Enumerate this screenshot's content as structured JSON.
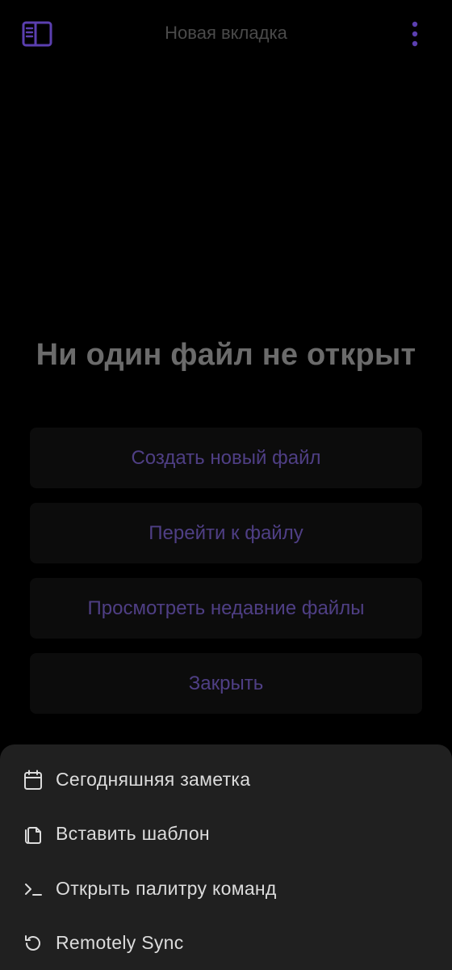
{
  "topbar": {
    "title": "Новая вкладка",
    "sidebar_icon": "sidebar-toggle-icon",
    "more_icon": "more-vertical-icon"
  },
  "empty_state": {
    "title": "Ни один файл не открыт",
    "actions": [
      {
        "label": "Создать новый файл"
      },
      {
        "label": "Перейти к файлу"
      },
      {
        "label": "Просмотреть недавние файлы"
      },
      {
        "label": "Закрыть"
      }
    ]
  },
  "sheet": {
    "items": [
      {
        "label": "Сегодняшняя заметка",
        "icon": "calendar-icon"
      },
      {
        "label": "Вставить шаблон",
        "icon": "files-icon"
      },
      {
        "label": "Открыть палитру команд",
        "icon": "terminal-icon"
      },
      {
        "label": "Remotely Sync",
        "icon": "sync-icon"
      }
    ]
  },
  "colors": {
    "accent": "#5b3fb0",
    "accent_text": "#4f3f85",
    "background": "#000000",
    "button_bg": "#0c0c0c",
    "sheet_bg": "#202020",
    "sheet_text": "#dcdcdc",
    "title_text": "#6b6b6b"
  }
}
